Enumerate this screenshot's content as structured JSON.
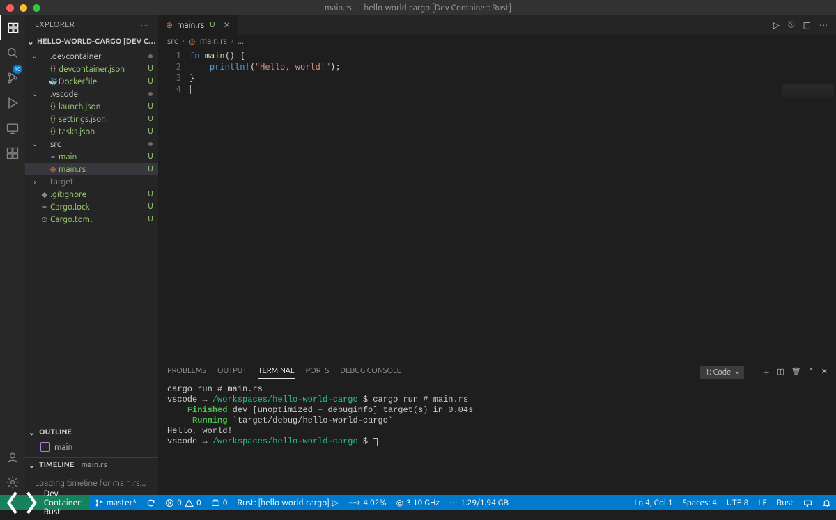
{
  "window_title": "main.rs — hello-world-cargo [Dev Container: Rust]",
  "sidebar": {
    "header": "EXPLORER",
    "folder_title": "HELLO-WORLD-CARGO [DEV CONTAINER:...",
    "tree": [
      {
        "type": "folder",
        "depth": 0,
        "label": ".devcontainer",
        "open": true,
        "badge": "dot"
      },
      {
        "type": "file",
        "depth": 1,
        "label": "devcontainer.json",
        "badge": "U",
        "icon": "{}",
        "color": "yellow"
      },
      {
        "type": "file",
        "depth": 1,
        "label": "Dockerfile",
        "badge": "U",
        "icon": "🐳",
        "color": "blue"
      },
      {
        "type": "folder",
        "depth": 0,
        "label": ".vscode",
        "open": true,
        "badge": "dot"
      },
      {
        "type": "file",
        "depth": 1,
        "label": "launch.json",
        "badge": "U",
        "icon": "{}",
        "color": "yellow"
      },
      {
        "type": "file",
        "depth": 1,
        "label": "settings.json",
        "badge": "U",
        "icon": "{}",
        "color": "yellow"
      },
      {
        "type": "file",
        "depth": 1,
        "label": "tasks.json",
        "badge": "U",
        "icon": "{}",
        "color": "yellow"
      },
      {
        "type": "folder",
        "depth": 0,
        "label": "src",
        "open": true,
        "badge": "dot"
      },
      {
        "type": "file",
        "depth": 1,
        "label": "main",
        "badge": "U",
        "icon": "≡",
        "color": "grey"
      },
      {
        "type": "file",
        "depth": 1,
        "label": "main.rs",
        "badge": "U",
        "icon": "⊕",
        "color": "rust",
        "selected": true
      },
      {
        "type": "folder",
        "depth": 0,
        "label": "target",
        "open": false,
        "badge": "",
        "muted": true
      },
      {
        "type": "file",
        "depth": 0,
        "label": ".gitignore",
        "badge": "U",
        "icon": "◆",
        "color": "grey"
      },
      {
        "type": "file",
        "depth": 0,
        "label": "Cargo.lock",
        "badge": "U",
        "icon": "≡",
        "color": "grey"
      },
      {
        "type": "file",
        "depth": 0,
        "label": "Cargo.toml",
        "badge": "U",
        "icon": "⊙",
        "color": "grey"
      }
    ],
    "outline_label": "OUTLINE",
    "outline_item": "main",
    "timeline_label": "TIMELINE",
    "timeline_file": "main.rs",
    "timeline_body": "Loading timeline for main.rs..."
  },
  "source_control_badge": "10",
  "tab": {
    "label": "main.rs",
    "badge": "U"
  },
  "breadcrumb": {
    "seg1": "src",
    "seg2": "main.rs",
    "seg3": "..."
  },
  "editor": {
    "line_numbers": [
      "1",
      "2",
      "3",
      "4"
    ],
    "code_tokens": [
      [
        {
          "c": "kw",
          "t": "fn "
        },
        {
          "c": "fn",
          "t": "main"
        },
        {
          "c": "",
          "t": "() {"
        }
      ],
      [
        {
          "c": "",
          "t": "    "
        },
        {
          "c": "macro",
          "t": "println!"
        },
        {
          "c": "",
          "t": "("
        },
        {
          "c": "str",
          "t": "\"Hello, world!\""
        },
        {
          "c": "",
          "t": ");"
        }
      ],
      [
        {
          "c": "",
          "t": "}"
        }
      ],
      []
    ]
  },
  "panel": {
    "tabs": {
      "problems": "PROBLEMS",
      "output": "OUTPUT",
      "terminal": "TERMINAL",
      "ports": "PORTS",
      "debug": "DEBUG CONSOLE"
    },
    "terminal_picker": "1: Code"
  },
  "terminal_lines": [
    {
      "segments": [
        {
          "c": "",
          "t": "cargo run # main.rs"
        }
      ]
    },
    {
      "segments": [
        {
          "c": "t-prompt",
          "t": "vscode"
        },
        {
          "c": "",
          "t": " → "
        },
        {
          "c": "t-path",
          "t": "/workspaces/hello-world-cargo"
        },
        {
          "c": "",
          "t": " $ cargo run # main.rs"
        }
      ]
    },
    {
      "segments": [
        {
          "c": "",
          "t": "    "
        },
        {
          "c": "t-green",
          "t": "Finished"
        },
        {
          "c": "",
          "t": " dev [unoptimized + debuginfo] target(s) in 0.04s"
        }
      ]
    },
    {
      "segments": [
        {
          "c": "",
          "t": "     "
        },
        {
          "c": "t-green",
          "t": "Running"
        },
        {
          "c": "",
          "t": " `target/debug/hello-world-cargo`"
        }
      ]
    },
    {
      "segments": [
        {
          "c": "",
          "t": "Hello, world!"
        }
      ]
    },
    {
      "segments": [
        {
          "c": "t-prompt",
          "t": "vscode"
        },
        {
          "c": "",
          "t": " → "
        },
        {
          "c": "t-path",
          "t": "/workspaces/hello-world-cargo"
        },
        {
          "c": "",
          "t": " $ "
        }
      ],
      "cursor": true
    }
  ],
  "statusbar": {
    "remote": "Dev Container: Rust",
    "branch": "master*",
    "errors": "0",
    "warnings": "0",
    "ra": "0",
    "rust_target": "Rust: [hello-world-cargo]",
    "cpu": "4.02%",
    "ghz": "3.10 GHz",
    "mem": "1.29/1.94 GB",
    "cursor": "Ln 4, Col 1",
    "spaces": "Spaces: 4",
    "encoding": "UTF-8",
    "eol": "LF",
    "lang": "Rust"
  }
}
